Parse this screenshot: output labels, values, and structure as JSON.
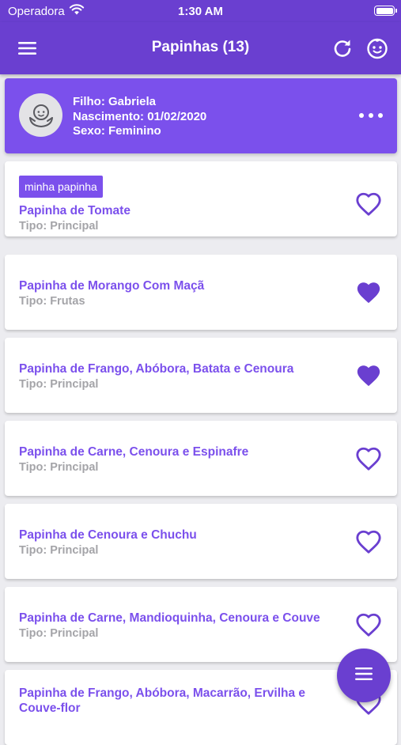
{
  "status_bar": {
    "carrier": "Operadora",
    "time": "1:30 AM"
  },
  "app_bar": {
    "title": "Papinhas (13)",
    "icons": [
      "menu-icon",
      "refresh-icon",
      "baby-face-icon"
    ]
  },
  "child": {
    "name_line": "Filho: Gabriela",
    "birth_line": "Nascimento: 01/02/2020",
    "sex_line": "Sexo: Feminino",
    "avatar_icon": "baby-icon",
    "menu_icon": "more-horizontal-icon"
  },
  "items": [
    {
      "tag": "minha papinha",
      "name": "Papinha de Tomate",
      "type": "Tipo: Principal",
      "favorite": false
    },
    {
      "name": "Papinha de Morango Com Maçã",
      "type": "Tipo: Frutas",
      "favorite": true
    },
    {
      "name": "Papinha de Frango, Abóbora, Batata e Cenoura",
      "type": "Tipo: Principal",
      "favorite": true
    },
    {
      "name": "Papinha de Carne, Cenoura e Espinafre",
      "type": "Tipo: Principal",
      "favorite": false
    },
    {
      "name": "Papinha de Cenoura e Chuchu",
      "type": "Tipo: Principal",
      "favorite": false
    },
    {
      "name": "Papinha de Carne, Mandioquinha, Cenoura e Couve",
      "type": "Tipo: Principal",
      "favorite": false
    },
    {
      "name": "Papinha de Frango, Abóbora, Macarrão, Ervilha e Couve-flor",
      "type": "",
      "favorite": false
    }
  ],
  "colors": {
    "primary": "#6a3fd0",
    "accent": "#7b50ec",
    "muted": "#a4a4a8",
    "background": "#ececf0"
  },
  "fab_icon": "menu-icon"
}
